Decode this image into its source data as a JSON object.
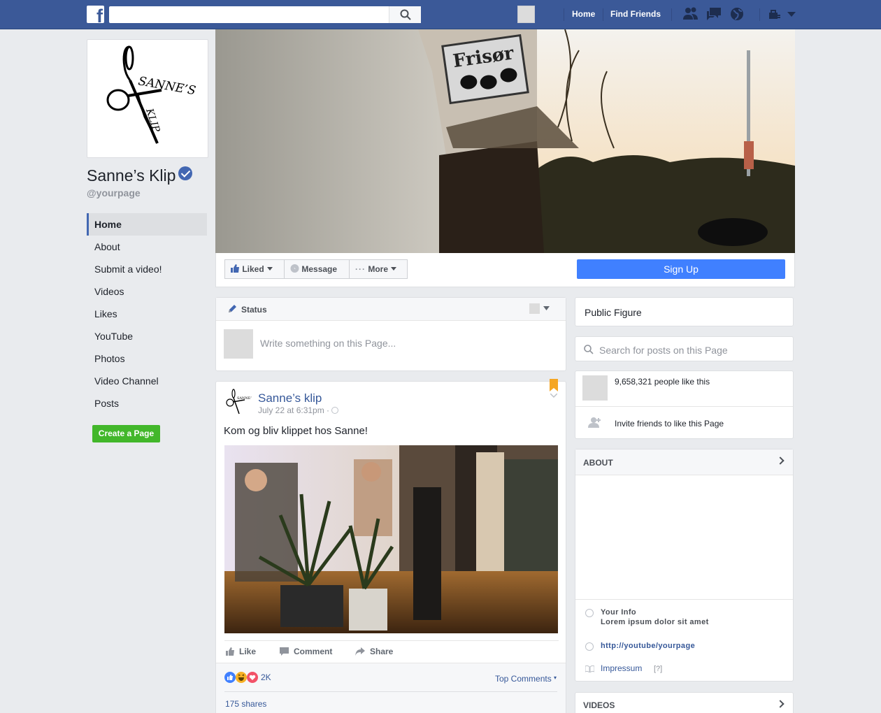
{
  "topbar": {
    "logo": "f",
    "search_placeholder": "",
    "home": "Home",
    "find_friends": "Find Friends"
  },
  "sidebar": {
    "page_name": "Sanne’s Klip",
    "handle": "@yourpage",
    "items": [
      {
        "label": "Home",
        "active": true
      },
      {
        "label": "About"
      },
      {
        "label": "Submit a video!"
      },
      {
        "label": "Videos"
      },
      {
        "label": "Likes"
      },
      {
        "label": "YouTube"
      },
      {
        "label": "Photos"
      },
      {
        "label": "Video Channel"
      },
      {
        "label": "Posts"
      }
    ],
    "create_page": "Create a Page"
  },
  "cover": {
    "sign_text": "Frisør"
  },
  "actions": {
    "liked": "Liked",
    "message": "Message",
    "more": "More",
    "sign_up": "Sign Up"
  },
  "composer": {
    "tab": "Status",
    "placeholder": "Write something on this Page..."
  },
  "post": {
    "author": "Sanne’s klip",
    "time": "July 22 at 6:31pm ·",
    "text": "Kom og bliv klippet hos Sanne!",
    "like": "Like",
    "comment": "Comment",
    "share": "Share",
    "reaction_count": "2K",
    "top_comments": "Top Comments",
    "shares": "175 shares"
  },
  "right": {
    "category": "Public Figure",
    "search_placeholder": "Search for posts on this Page",
    "likes": "9,658,321 people like this",
    "invite": "Invite friends to like this Page",
    "about_title": "ABOUT",
    "your_info_title": "Your Info",
    "your_info_text": "Lorem ipsum dolor sit amet",
    "youtube_link": "http://youtube/yourpage",
    "impressum": "Impressum",
    "impressum_note": "[?]",
    "videos_title": "VIDEOS"
  },
  "colors": {
    "brand": "#3b5998",
    "signup": "#4080ff",
    "create_page": "#42b72a",
    "link": "#365899"
  }
}
